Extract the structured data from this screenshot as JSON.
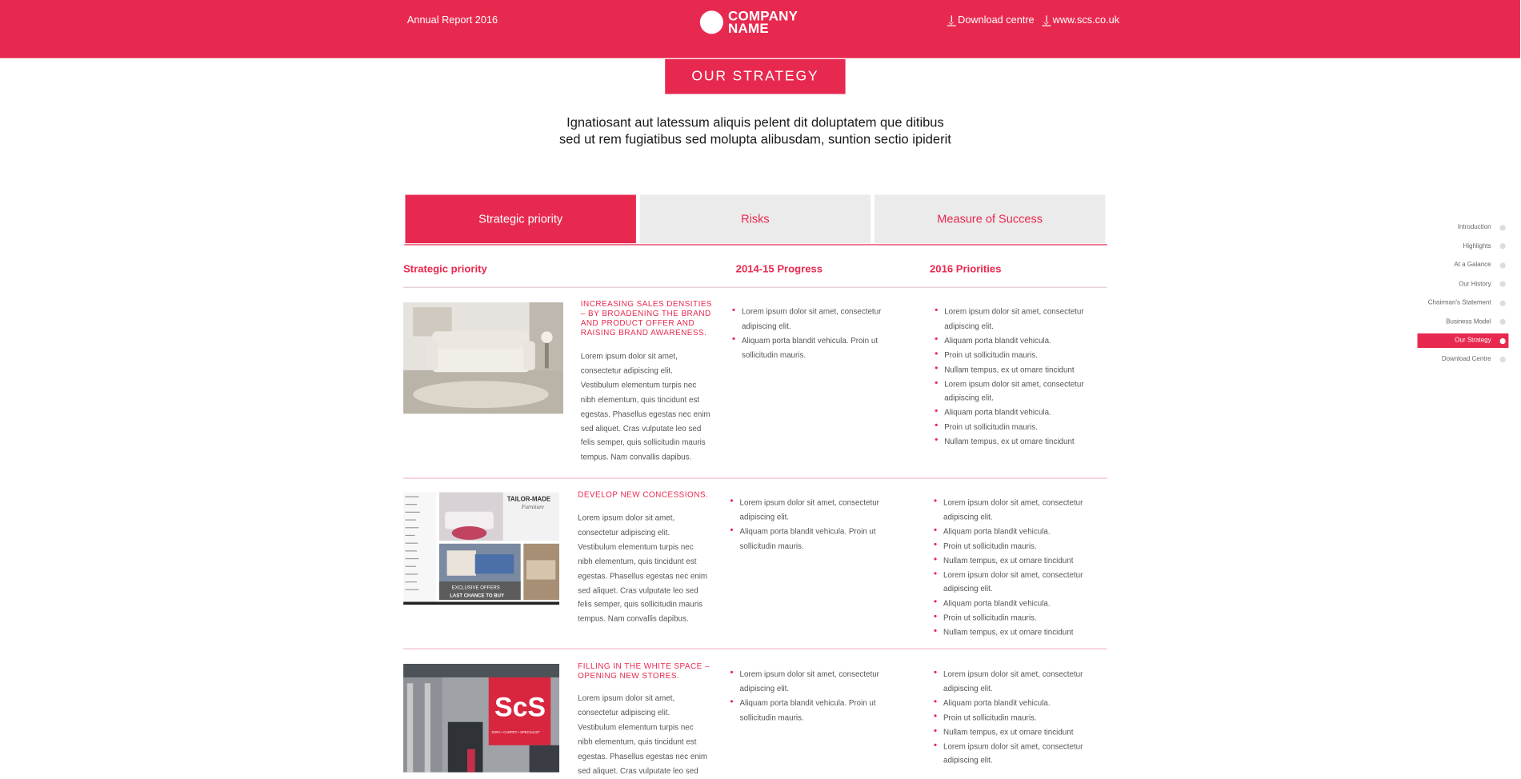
{
  "header": {
    "annual_report": "Annual Report 2016",
    "logo_line1": "COMPANY",
    "logo_line2": "NAME",
    "download_centre": "Download centre",
    "website": "www.scs.co.uk"
  },
  "banner": "OUR STRATEGY",
  "intro": "Ignatiosant aut latessum aliquis pelent dit doluptatem que ditibus sed ut rem fugiatibus sed molupta alibusdam, suntion sectio ipiderit",
  "tabs": [
    "Strategic priority",
    "Risks",
    "Measure of Success"
  ],
  "columns": [
    "Strategic priority",
    "2014-15 Progress",
    "2016 Priorities"
  ],
  "rows": [
    {
      "title": "INCREASING SALES DENSITIES – BY BROADENING THE BRAND AND PRODUCT OFFER AND RAISING BRAND AWARENESS.",
      "body": "Lorem ipsum dolor sit amet, consectetur adipiscing elit. Vestibulum elementum turpis nec nibh elementum, quis tincidunt est egestas. Phasellus egestas nec enim sed aliquet. Cras vulputate leo sed felis semper, quis sollicitudin mauris tempus. Nam convallis dapibus.",
      "progress": [
        "Lorem ipsum dolor sit amet, consectetur adipiscing elit.",
        "Aliquam porta blandit vehicula. Proin ut sollicitudin mauris."
      ],
      "priorities": [
        "Lorem ipsum dolor sit amet, consectetur adipiscing elit.",
        "Aliquam porta blandit vehicula.",
        "Proin ut sollicitudin mauris.",
        "Nullam tempus, ex ut ornare tincidunt",
        "Lorem ipsum dolor sit amet, consectetur adipiscing elit.",
        "Aliquam porta blandit vehicula.",
        "Proin ut sollicitudin mauris.",
        "Nullam tempus, ex ut ornare tincidunt"
      ]
    },
    {
      "title": "DEVELOP NEW CONCESSIONS.",
      "body": "Lorem ipsum dolor sit amet, consectetur adipiscing elit. Vestibulum elementum turpis nec nibh elementum, quis tincidunt est egestas. Phasellus egestas nec enim sed aliquet. Cras vulputate leo sed felis semper, quis sollicitudin mauris tempus. Nam convallis dapibus.",
      "progress": [
        "Lorem ipsum dolor sit amet, consectetur adipiscing elit.",
        "Aliquam porta blandit vehicula. Proin ut sollicitudin mauris."
      ],
      "priorities": [
        "Lorem ipsum dolor sit amet, consectetur adipiscing elit.",
        "Aliquam porta blandit vehicula.",
        "Proin ut sollicitudin mauris.",
        "Nullam tempus, ex ut ornare tincidunt",
        "Lorem ipsum dolor sit amet, consectetur adipiscing elit.",
        "Aliquam porta blandit vehicula.",
        "Proin ut sollicitudin mauris.",
        "Nullam tempus, ex ut ornare tincidunt"
      ],
      "promo_heading": "TAILOR-MADE",
      "promo_script": "Furniture",
      "promo_offer": "EXCLUSIVE OFFERS",
      "promo_chance": "LAST CHANCE TO BUY"
    },
    {
      "title": "FILLING IN THE WHITE SPACE – OPENING NEW STORES.",
      "body": "Lorem ipsum dolor sit amet, consectetur adipiscing elit. Vestibulum elementum turpis nec nibh elementum, quis tincidunt est egestas. Phasellus egestas nec enim sed aliquet. Cras vulputate leo sed",
      "progress": [
        "Lorem ipsum dolor sit amet, consectetur adipiscing elit.",
        "Aliquam porta blandit vehicula. Proin ut sollicitudin mauris."
      ],
      "priorities": [
        "Lorem ipsum dolor sit amet, consectetur adipiscing elit.",
        "Aliquam porta blandit vehicula.",
        "Proin ut sollicitudin mauris.",
        "Nullam tempus, ex ut ornare tincidunt",
        "Lorem ipsum dolor sit amet, consectetur adipiscing elit."
      ],
      "store_sign": "ScS",
      "store_subsign": "SOFA • CARPET • SPECIALIST"
    }
  ],
  "sidenav": [
    "Introduction",
    "Highlights",
    "At a Galance",
    "Our History",
    "Chairman's Statement",
    "Business Model",
    "Our Strategy",
    "Download Centre"
  ],
  "colors": {
    "accent": "#e8294f",
    "tab_inactive": "#ebebeb"
  }
}
